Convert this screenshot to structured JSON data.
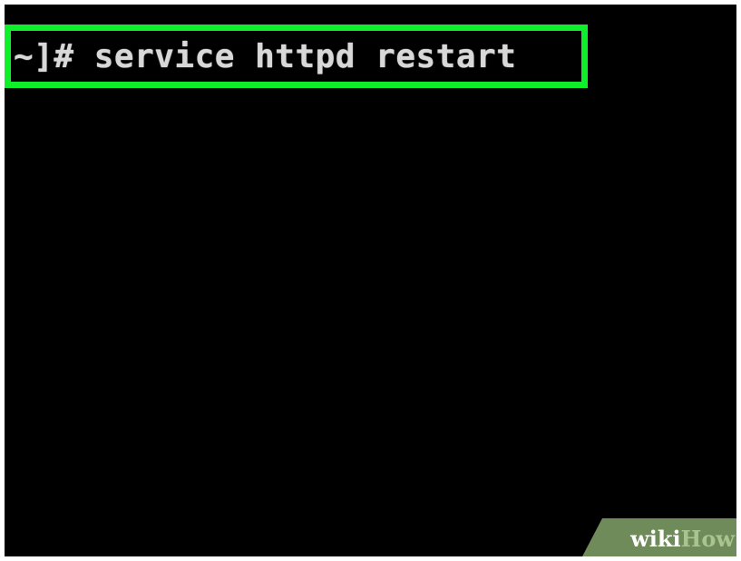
{
  "terminal": {
    "prompt": "~]#",
    "command": "service httpd restart"
  },
  "highlight": {
    "color": "#0ef02a"
  },
  "watermark": {
    "part1": "wiki",
    "part2": "How"
  },
  "colors": {
    "background": "#000000",
    "text": "#d8d8d8",
    "frame": "#ffffff",
    "watermark_bg": "#6f8b5a"
  }
}
